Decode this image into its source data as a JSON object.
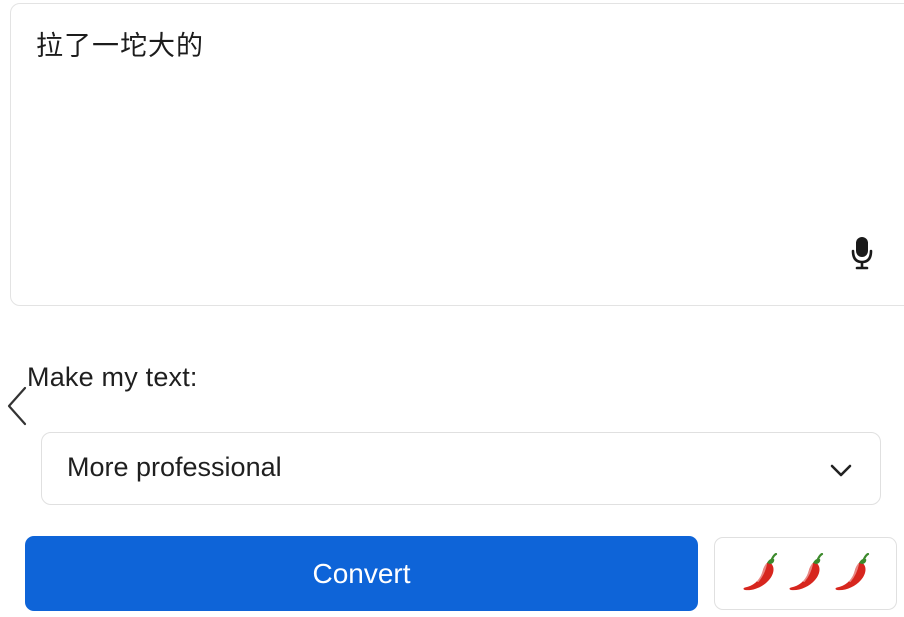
{
  "editor": {
    "text": "拉了一坨大的",
    "mic_icon": "microphone-icon"
  },
  "nav": {
    "back_icon": "chevron-left-icon"
  },
  "options": {
    "label": "Make my text:",
    "selected_style": "More professional",
    "dropdown_icon": "chevron-down-icon"
  },
  "actions": {
    "convert_label": "Convert",
    "spice_level": 3,
    "spice_icon": "chili-pepper-icon"
  },
  "colors": {
    "accent": "#0e64d8",
    "chili": "#d7261e",
    "border": "#e0e0e0"
  }
}
